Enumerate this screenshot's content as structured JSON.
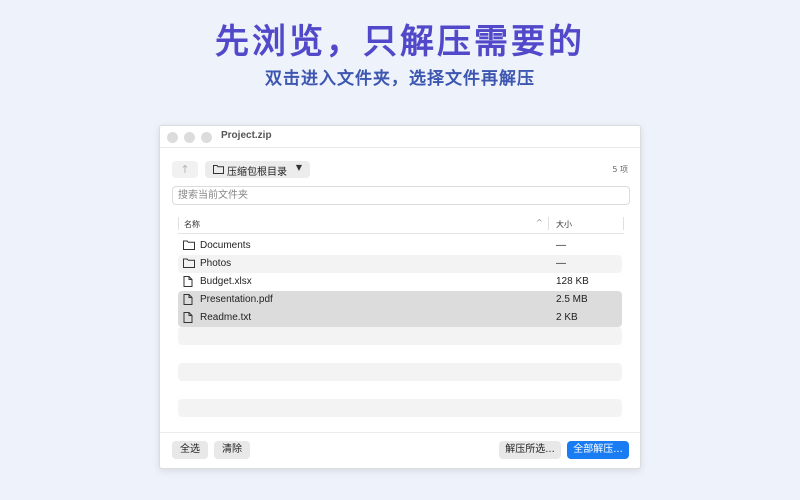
{
  "promo": {
    "headline": "先浏览，只解压需要的",
    "subheadline": "双击进入文件夹，选择文件再解压"
  },
  "window": {
    "title": "Project.zip"
  },
  "toolbar": {
    "up_icon": "arrow-up-icon",
    "path_label": "压缩包根目录",
    "item_count": "5 项"
  },
  "search": {
    "placeholder": "搜索当前文件夹"
  },
  "table": {
    "columns": [
      "名称",
      "大小"
    ],
    "sort_indicator": "^",
    "rows": [
      {
        "icon": "folder-icon",
        "name": "Documents",
        "size": "—",
        "selected": false
      },
      {
        "icon": "folder-icon",
        "name": "Photos",
        "size": "—",
        "selected": false
      },
      {
        "icon": "file-icon",
        "name": "Budget.xlsx",
        "size": "128 KB",
        "selected": false
      },
      {
        "icon": "file-icon",
        "name": "Presentation.pdf",
        "size": "2.5 MB",
        "selected": true
      },
      {
        "icon": "file-icon",
        "name": "Readme.txt",
        "size": "2 KB",
        "selected": true
      }
    ]
  },
  "footer": {
    "select_all": "全选",
    "clear": "清除",
    "extract_selected": "解压所选...",
    "extract_all": "全部解压..."
  },
  "colors": {
    "headline": "#5149c9",
    "subheadline": "#3d56b0",
    "accent": "#1a7cf2",
    "selection": "#dcdcdc"
  }
}
